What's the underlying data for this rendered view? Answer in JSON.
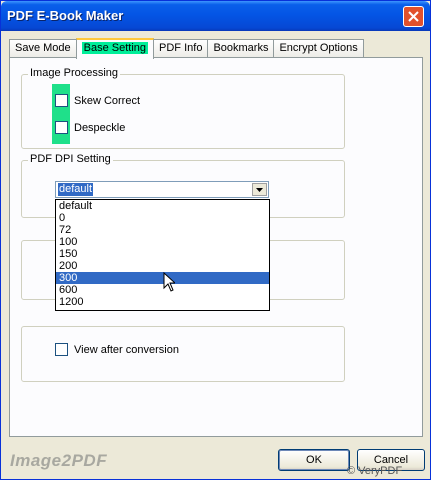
{
  "window": {
    "title": "PDF E-Book Maker"
  },
  "tabs": [
    {
      "label": "Save Mode",
      "active": false
    },
    {
      "label": "Base Setting",
      "active": true
    },
    {
      "label": "PDF Info",
      "active": false
    },
    {
      "label": "Bookmarks",
      "active": false
    },
    {
      "label": "Encrypt Options",
      "active": false
    }
  ],
  "image_processing": {
    "label": "Image Processing",
    "options": [
      {
        "label": "Skew Correct",
        "checked": false
      },
      {
        "label": "Despeckle",
        "checked": false
      }
    ]
  },
  "dpi": {
    "label": "PDF DPI Setting",
    "selected": "default",
    "options": [
      "default",
      "0",
      "72",
      "100",
      "150",
      "200",
      "300",
      "600",
      "1200"
    ],
    "highlighted": "300"
  },
  "view_after": {
    "label": "View after conversion",
    "checked": false
  },
  "brand": "Image2PDF",
  "buttons": {
    "ok": "OK",
    "cancel": "Cancel"
  },
  "watermark": "© VeryPDF",
  "colors": {
    "highlight": "#1fe08a",
    "selection": "#316ac5",
    "titlebar": "#0455e5"
  }
}
